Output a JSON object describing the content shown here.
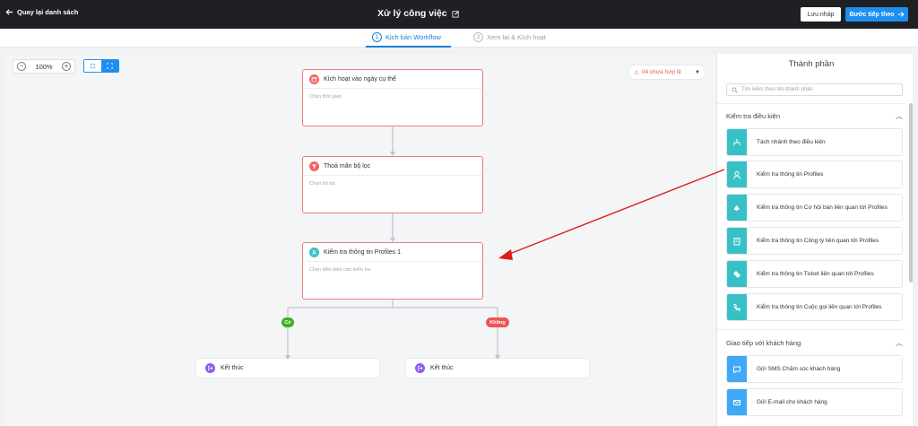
{
  "header": {
    "back_label": "Quay lại danh sách",
    "title": "Xử lý công việc",
    "draft_label": "Lưu nháp",
    "next_label": "Bước tiếp theo"
  },
  "steps": [
    {
      "num": "1",
      "label": "Kịch bản Workflow"
    },
    {
      "num": "2",
      "label": "Xem lại & Kích hoạt"
    }
  ],
  "toolbar": {
    "zoom": "100%",
    "zoom_out": "−",
    "zoom_in": "+",
    "invalid_label": "04 chưa hợp lệ"
  },
  "workflow": {
    "nodes": [
      {
        "title": "Kích hoạt vào ngày cụ thể",
        "sub": "Chọn thời gian",
        "icon": "calendar-icon"
      },
      {
        "title": "Thoả mãn bộ lọc",
        "sub": "Chọn bộ lọc",
        "icon": "filter-icon"
      },
      {
        "title": "Kiểm tra thông tin Profiles 1",
        "sub": "Chọn điều kiện cần kiểm tra",
        "icon": "profiles-icon"
      }
    ],
    "branch_yes": "Có",
    "branch_no": "Không",
    "end_left": "Kết thúc",
    "end_right": "Kết thúc"
  },
  "panel": {
    "title": "Thành phần",
    "search_placeholder": "Tìm kiếm theo tên thành phần",
    "section1": "Kiểm tra điều kiện",
    "section2": "Giao tiếp với khách hàng",
    "components1": [
      {
        "label": "Tách nhánh theo điều kiện",
        "icon": "branch-icon"
      },
      {
        "label": "Kiểm tra thông tin Profiles",
        "icon": "user-icon"
      },
      {
        "label": "Kiểm tra thông tin Cơ hội bán liên quan tới Profiles",
        "icon": "opportunity-icon"
      },
      {
        "label": "Kiểm tra thông tin Công ty liên quan tới Profiles",
        "icon": "company-icon"
      },
      {
        "label": "Kiểm tra thông tin Ticket liên quan tới Profiles",
        "icon": "ticket-icon"
      },
      {
        "label": "Kiểm tra thông tin Cuộc gọi liên quan tới Profiles",
        "icon": "phone-icon"
      }
    ],
    "components2": [
      {
        "label": "Gửi SMS Chăm sóc khách hàng",
        "icon": "sms-icon"
      },
      {
        "label": "Gửi E-mail cho khách hàng",
        "icon": "email-icon"
      }
    ]
  },
  "colors": {
    "accent": "#1d8ff0",
    "node_border": "#f07a7a",
    "teal": "#37c1c6",
    "sky": "#3ea9f5",
    "yes": "#3cb11f",
    "no": "#ec5454",
    "end": "#8e5ff0",
    "arrow": "#e11b1b"
  }
}
